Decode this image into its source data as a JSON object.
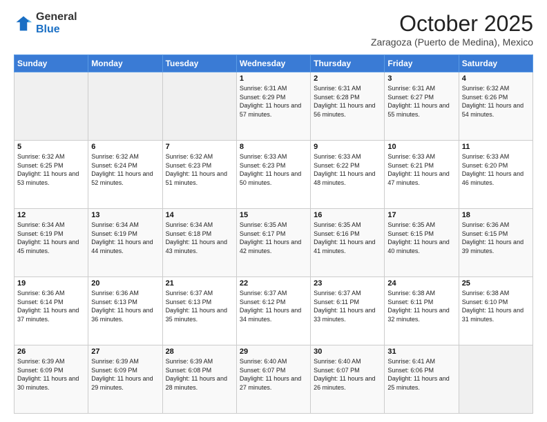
{
  "logo": {
    "general": "General",
    "blue": "Blue"
  },
  "header": {
    "month": "October 2025",
    "subtitle": "Zaragoza (Puerto de Medina), Mexico"
  },
  "days_of_week": [
    "Sunday",
    "Monday",
    "Tuesday",
    "Wednesday",
    "Thursday",
    "Friday",
    "Saturday"
  ],
  "weeks": [
    [
      {
        "day": "",
        "sunrise": "",
        "sunset": "",
        "daylight": ""
      },
      {
        "day": "",
        "sunrise": "",
        "sunset": "",
        "daylight": ""
      },
      {
        "day": "",
        "sunrise": "",
        "sunset": "",
        "daylight": ""
      },
      {
        "day": "1",
        "sunrise": "Sunrise: 6:31 AM",
        "sunset": "Sunset: 6:29 PM",
        "daylight": "Daylight: 11 hours and 57 minutes."
      },
      {
        "day": "2",
        "sunrise": "Sunrise: 6:31 AM",
        "sunset": "Sunset: 6:28 PM",
        "daylight": "Daylight: 11 hours and 56 minutes."
      },
      {
        "day": "3",
        "sunrise": "Sunrise: 6:31 AM",
        "sunset": "Sunset: 6:27 PM",
        "daylight": "Daylight: 11 hours and 55 minutes."
      },
      {
        "day": "4",
        "sunrise": "Sunrise: 6:32 AM",
        "sunset": "Sunset: 6:26 PM",
        "daylight": "Daylight: 11 hours and 54 minutes."
      }
    ],
    [
      {
        "day": "5",
        "sunrise": "Sunrise: 6:32 AM",
        "sunset": "Sunset: 6:25 PM",
        "daylight": "Daylight: 11 hours and 53 minutes."
      },
      {
        "day": "6",
        "sunrise": "Sunrise: 6:32 AM",
        "sunset": "Sunset: 6:24 PM",
        "daylight": "Daylight: 11 hours and 52 minutes."
      },
      {
        "day": "7",
        "sunrise": "Sunrise: 6:32 AM",
        "sunset": "Sunset: 6:23 PM",
        "daylight": "Daylight: 11 hours and 51 minutes."
      },
      {
        "day": "8",
        "sunrise": "Sunrise: 6:33 AM",
        "sunset": "Sunset: 6:23 PM",
        "daylight": "Daylight: 11 hours and 50 minutes."
      },
      {
        "day": "9",
        "sunrise": "Sunrise: 6:33 AM",
        "sunset": "Sunset: 6:22 PM",
        "daylight": "Daylight: 11 hours and 48 minutes."
      },
      {
        "day": "10",
        "sunrise": "Sunrise: 6:33 AM",
        "sunset": "Sunset: 6:21 PM",
        "daylight": "Daylight: 11 hours and 47 minutes."
      },
      {
        "day": "11",
        "sunrise": "Sunrise: 6:33 AM",
        "sunset": "Sunset: 6:20 PM",
        "daylight": "Daylight: 11 hours and 46 minutes."
      }
    ],
    [
      {
        "day": "12",
        "sunrise": "Sunrise: 6:34 AM",
        "sunset": "Sunset: 6:19 PM",
        "daylight": "Daylight: 11 hours and 45 minutes."
      },
      {
        "day": "13",
        "sunrise": "Sunrise: 6:34 AM",
        "sunset": "Sunset: 6:19 PM",
        "daylight": "Daylight: 11 hours and 44 minutes."
      },
      {
        "day": "14",
        "sunrise": "Sunrise: 6:34 AM",
        "sunset": "Sunset: 6:18 PM",
        "daylight": "Daylight: 11 hours and 43 minutes."
      },
      {
        "day": "15",
        "sunrise": "Sunrise: 6:35 AM",
        "sunset": "Sunset: 6:17 PM",
        "daylight": "Daylight: 11 hours and 42 minutes."
      },
      {
        "day": "16",
        "sunrise": "Sunrise: 6:35 AM",
        "sunset": "Sunset: 6:16 PM",
        "daylight": "Daylight: 11 hours and 41 minutes."
      },
      {
        "day": "17",
        "sunrise": "Sunrise: 6:35 AM",
        "sunset": "Sunset: 6:15 PM",
        "daylight": "Daylight: 11 hours and 40 minutes."
      },
      {
        "day": "18",
        "sunrise": "Sunrise: 6:36 AM",
        "sunset": "Sunset: 6:15 PM",
        "daylight": "Daylight: 11 hours and 39 minutes."
      }
    ],
    [
      {
        "day": "19",
        "sunrise": "Sunrise: 6:36 AM",
        "sunset": "Sunset: 6:14 PM",
        "daylight": "Daylight: 11 hours and 37 minutes."
      },
      {
        "day": "20",
        "sunrise": "Sunrise: 6:36 AM",
        "sunset": "Sunset: 6:13 PM",
        "daylight": "Daylight: 11 hours and 36 minutes."
      },
      {
        "day": "21",
        "sunrise": "Sunrise: 6:37 AM",
        "sunset": "Sunset: 6:13 PM",
        "daylight": "Daylight: 11 hours and 35 minutes."
      },
      {
        "day": "22",
        "sunrise": "Sunrise: 6:37 AM",
        "sunset": "Sunset: 6:12 PM",
        "daylight": "Daylight: 11 hours and 34 minutes."
      },
      {
        "day": "23",
        "sunrise": "Sunrise: 6:37 AM",
        "sunset": "Sunset: 6:11 PM",
        "daylight": "Daylight: 11 hours and 33 minutes."
      },
      {
        "day": "24",
        "sunrise": "Sunrise: 6:38 AM",
        "sunset": "Sunset: 6:11 PM",
        "daylight": "Daylight: 11 hours and 32 minutes."
      },
      {
        "day": "25",
        "sunrise": "Sunrise: 6:38 AM",
        "sunset": "Sunset: 6:10 PM",
        "daylight": "Daylight: 11 hours and 31 minutes."
      }
    ],
    [
      {
        "day": "26",
        "sunrise": "Sunrise: 6:39 AM",
        "sunset": "Sunset: 6:09 PM",
        "daylight": "Daylight: 11 hours and 30 minutes."
      },
      {
        "day": "27",
        "sunrise": "Sunrise: 6:39 AM",
        "sunset": "Sunset: 6:09 PM",
        "daylight": "Daylight: 11 hours and 29 minutes."
      },
      {
        "day": "28",
        "sunrise": "Sunrise: 6:39 AM",
        "sunset": "Sunset: 6:08 PM",
        "daylight": "Daylight: 11 hours and 28 minutes."
      },
      {
        "day": "29",
        "sunrise": "Sunrise: 6:40 AM",
        "sunset": "Sunset: 6:07 PM",
        "daylight": "Daylight: 11 hours and 27 minutes."
      },
      {
        "day": "30",
        "sunrise": "Sunrise: 6:40 AM",
        "sunset": "Sunset: 6:07 PM",
        "daylight": "Daylight: 11 hours and 26 minutes."
      },
      {
        "day": "31",
        "sunrise": "Sunrise: 6:41 AM",
        "sunset": "Sunset: 6:06 PM",
        "daylight": "Daylight: 11 hours and 25 minutes."
      },
      {
        "day": "",
        "sunrise": "",
        "sunset": "",
        "daylight": ""
      }
    ]
  ]
}
